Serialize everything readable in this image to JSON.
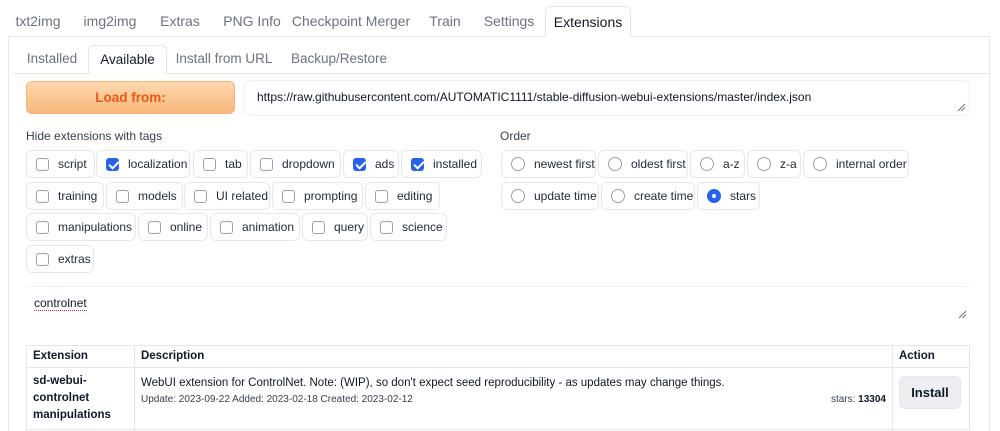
{
  "top_tabs": [
    "txt2img",
    "img2img",
    "Extras",
    "PNG Info",
    "Checkpoint Merger",
    "Train",
    "Settings",
    "Extensions"
  ],
  "sub_tabs": [
    "Installed",
    "Available",
    "Install from URL",
    "Backup/Restore"
  ],
  "load_button": "Load from:",
  "url_value": "https://raw.githubusercontent.com/AUTOMATIC1111/stable-diffusion-webui-extensions/master/index.json",
  "hide_label": "Hide extensions with tags",
  "order_label": "Order",
  "tags": [
    {
      "label": "script",
      "checked": false
    },
    {
      "label": "localization",
      "checked": true
    },
    {
      "label": "tab",
      "checked": false
    },
    {
      "label": "dropdown",
      "checked": false
    },
    {
      "label": "ads",
      "checked": true
    },
    {
      "label": "installed",
      "checked": true
    },
    {
      "label": "training",
      "checked": false
    },
    {
      "label": "models",
      "checked": false
    },
    {
      "label": "UI related",
      "checked": false
    },
    {
      "label": "prompting",
      "checked": false
    },
    {
      "label": "editing",
      "checked": false
    },
    {
      "label": "manipulations",
      "checked": false
    },
    {
      "label": "online",
      "checked": false
    },
    {
      "label": "animation",
      "checked": false
    },
    {
      "label": "query",
      "checked": false
    },
    {
      "label": "science",
      "checked": false
    },
    {
      "label": "extras",
      "checked": false
    }
  ],
  "order_options": [
    {
      "label": "newest first",
      "selected": false
    },
    {
      "label": "oldest first",
      "selected": false
    },
    {
      "label": "a-z",
      "selected": false
    },
    {
      "label": "z-a",
      "selected": false
    },
    {
      "label": "internal order",
      "selected": false
    },
    {
      "label": "update time",
      "selected": false
    },
    {
      "label": "create time",
      "selected": false
    },
    {
      "label": "stars",
      "selected": true
    }
  ],
  "search_value": "controlnet",
  "table": {
    "headers": [
      "Extension",
      "Description",
      "Action"
    ],
    "rows": [
      {
        "name": "sd-webui-controlnet manipulations",
        "name_lines": [
          "sd-webui-",
          "controlnet",
          "manipulations"
        ],
        "description": "WebUI extension for ControlNet. Note: (WIP), so don't expect seed reproducibility - as updates may change things.",
        "meta": "Update: 2023-09-22 Added: 2023-02-18 Created: 2023-02-12",
        "stars_label": "stars:",
        "stars": "13304",
        "action": "Install"
      }
    ]
  },
  "colors": {
    "accent": "#2563eb",
    "load_text": "#e8591a"
  }
}
